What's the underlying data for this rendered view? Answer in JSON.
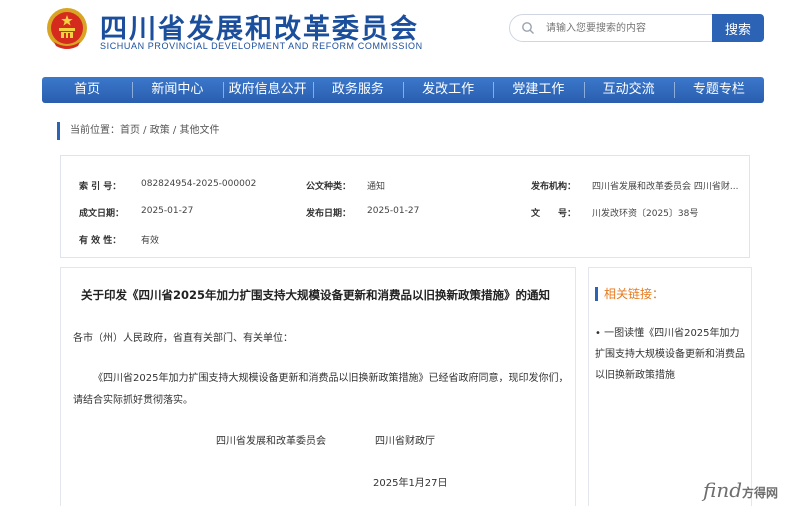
{
  "header": {
    "title": "四川省发展和改革委员会",
    "subtitle": "SICHUAN PROVINCIAL DEVELOPMENT AND REFORM COMMISSION",
    "search_placeholder": "请输入您要搜索的内容",
    "search_button": "搜索"
  },
  "nav": {
    "items": [
      "首页",
      "新闻中心",
      "政府信息公开",
      "政务服务",
      "发改工作",
      "党建工作",
      "互动交流",
      "专题专栏"
    ]
  },
  "breadcrumb": {
    "text": "当前位置：首页 / 政策 / 其他文件"
  },
  "meta": {
    "index_no_label": "索 引 号：",
    "index_no": "082824954-2025-000002",
    "doc_type_label": "公文种类：",
    "doc_type": "通知",
    "issuer_label": "发布机构：",
    "issuer": "四川省发展和改革委员会 四川省财...",
    "created_label": "成文日期：",
    "created": "2025-01-27",
    "published_label": "发布日期：",
    "published": "2025-01-27",
    "doc_no_label": "文　　号：",
    "doc_no": "川发改环资〔2025〕38号",
    "validity_label": "有 效 性：",
    "validity": "有效"
  },
  "article": {
    "title": "关于印发《四川省2025年加力扩围支持大规模设备更新和消费品以旧换新政策措施》的通知",
    "salutation": "各市（州）人民政府，省直有关部门、有关单位：",
    "body": "《四川省2025年加力扩围支持大规模设备更新和消费品以旧换新政策措施》已经省政府同意，现印发你们，请结合实际抓好贯彻落实。",
    "signer_1": "四川省发展和改革委员会",
    "signer_2": "四川省财政厅",
    "date": "2025年1月27日"
  },
  "sidebar": {
    "related_title": "相关链接：",
    "link_1": "• 一图读懂《四川省2025年加力扩围支持大规模设备更新和消费品以旧换新政策措施"
  },
  "watermark": {
    "find": "find",
    "cn": "方得网"
  },
  "colors": {
    "brand_blue": "#2d63b5",
    "accent_orange": "#e57a1f"
  }
}
